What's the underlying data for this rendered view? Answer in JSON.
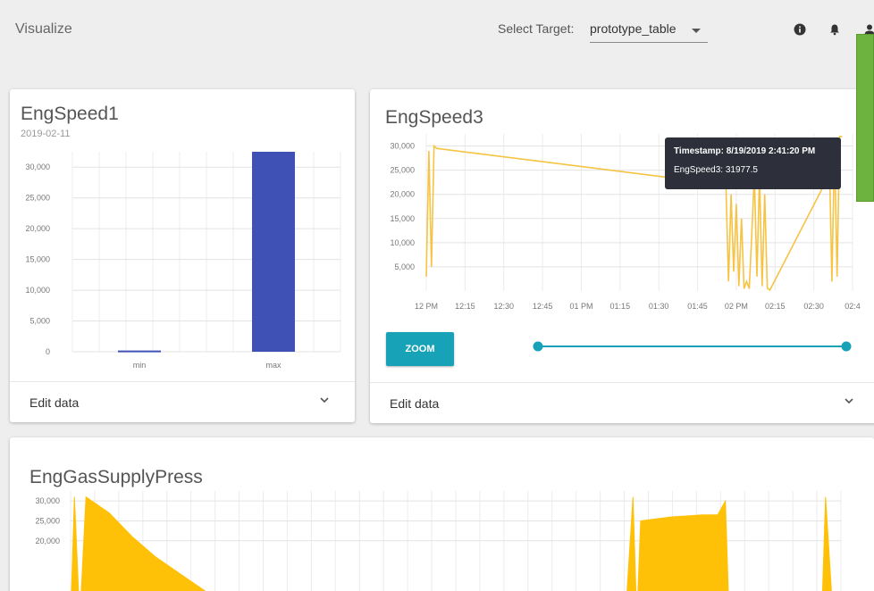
{
  "header": {
    "app_title": "Visualize",
    "target_label": "Select Target:",
    "target_value": "prototype_table",
    "icons": [
      "info-icon",
      "bell-icon",
      "user-icon"
    ]
  },
  "colors": {
    "bar": "#3f51b5",
    "line": "#f6c343",
    "area": "#ffc107",
    "zoom": "#17a2b8",
    "slider": "#17a2b8",
    "tooltip_bg": "#2d2f3a",
    "green_panel": "#6db33f"
  },
  "cards": {
    "engspeed1": {
      "title": "EngSpeed1",
      "subtitle": "2019-02-11",
      "footer_label": "Edit data"
    },
    "engspeed3": {
      "title": "EngSpeed3",
      "zoom_label": "ZOOM",
      "footer_label": "Edit data"
    },
    "enggas": {
      "title": "EngGasSupplyPress"
    }
  },
  "tooltip": {
    "line1": "Timestamp: 8/19/2019 2:41:20 PM",
    "line2": "EngSpeed3: 31977.5"
  },
  "chart_data": [
    {
      "type": "bar",
      "categories": [
        "min",
        "max"
      ],
      "values": [
        200,
        32500
      ],
      "y_ticks": [
        "30,000",
        "25,000",
        "20,000",
        "15,000",
        "10,000",
        "5,000",
        "0"
      ],
      "ylim": [
        0,
        32500
      ]
    },
    {
      "type": "line",
      "x_ticks": [
        "12 PM",
        "12:15",
        "12:30",
        "12:45",
        "01 PM",
        "01:15",
        "01:30",
        "01:45",
        "02 PM",
        "02:15",
        "02:30",
        "02:4"
      ],
      "y_ticks": [
        "30,000",
        "25,000",
        "20,000",
        "15,000",
        "10,000",
        "5,000"
      ],
      "ylim": [
        0,
        32500
      ],
      "series": [
        {
          "x": [
            "12:00",
            "12:01",
            "12:02",
            "12:03",
            "12:04",
            "01:56",
            "01:57",
            "01:58",
            "01:59",
            "02:00",
            "02:01",
            "02:02",
            "02:03",
            "02:04",
            "02:05",
            "02:06",
            "02:07",
            "02:08",
            "02:09",
            "02:10",
            "02:11",
            "02:12",
            "02:13",
            "02:35",
            "02:36",
            "02:37",
            "02:38",
            "02:39",
            "02:40",
            "02:41"
          ],
          "y": [
            3000,
            29000,
            5000,
            30000,
            29500,
            22000,
            2000,
            20000,
            4000,
            18000,
            1000,
            15000,
            500,
            2000,
            500,
            12000,
            24000,
            3000,
            24000,
            1000,
            20000,
            600,
            200,
            23000,
            28000,
            2000,
            30000,
            3000,
            31977.5,
            31977.5
          ]
        }
      ]
    },
    {
      "type": "area",
      "y_ticks": [
        "30,000",
        "25,000",
        "20,000"
      ],
      "y": [
        31000,
        0,
        31000,
        27000,
        21000,
        16000,
        12000,
        8000,
        4000,
        2000,
        0,
        0,
        0,
        0,
        0,
        0,
        31000,
        0,
        25000,
        26000,
        26500,
        26500,
        30000,
        0,
        0,
        0,
        31000,
        0
      ]
    }
  ]
}
